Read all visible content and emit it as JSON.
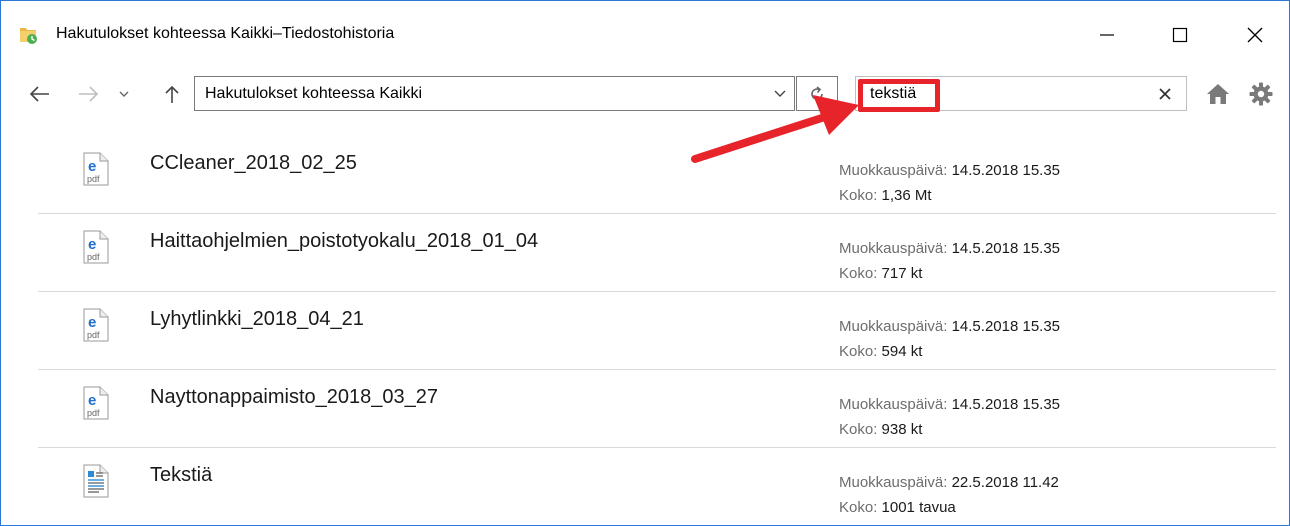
{
  "window": {
    "title": "Hakutulokset kohteessa Kaikki–Tiedostohistoria"
  },
  "navigation": {
    "address": "Hakutulokset kohteessa Kaikki",
    "search_value": "tekstiä"
  },
  "labels": {
    "modified": "Muokkauspäivä:",
    "size": "Koko:"
  },
  "files": [
    {
      "name": "CCleaner_2018_02_25",
      "icon": "pdf-icon",
      "modified": "14.5.2018 15.35",
      "size": "1,36 Mt"
    },
    {
      "name": "Haittaohjelmien_poistotyokalu_2018_01_04",
      "icon": "pdf-icon",
      "modified": "14.5.2018 15.35",
      "size": "717 kt"
    },
    {
      "name": "Lyhytlinkki_2018_04_21",
      "icon": "pdf-icon",
      "modified": "14.5.2018 15.35",
      "size": "594 kt"
    },
    {
      "name": "Nayttonappaimisto_2018_03_27",
      "icon": "pdf-icon",
      "modified": "14.5.2018 15.35",
      "size": "938 kt"
    },
    {
      "name": "Tekstiä",
      "icon": "text-document-icon",
      "modified": "22.5.2018 11.42",
      "size": "1001 tavua"
    }
  ],
  "colors": {
    "window_border": "#2b78d4",
    "highlight": "#e8242b",
    "pdf_blue": "#1f6fcf"
  }
}
